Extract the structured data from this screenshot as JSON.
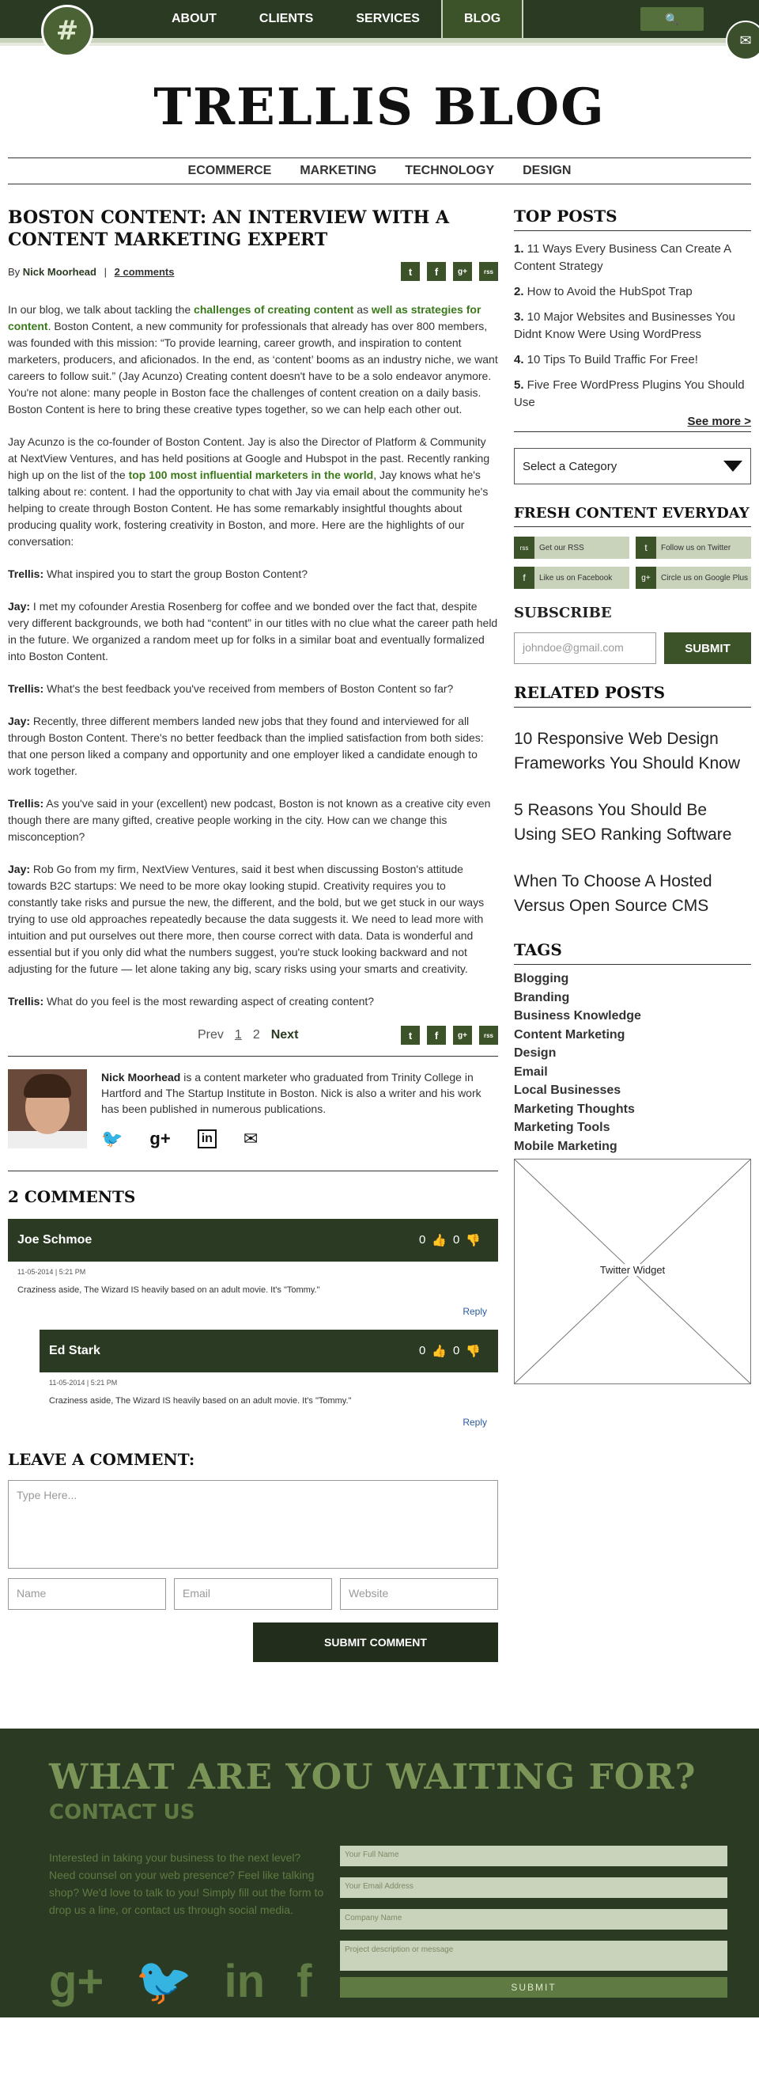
{
  "nav": {
    "logo_glyph": "#",
    "items": [
      "ABOUT",
      "CLIENTS",
      "SERVICES",
      "BLOG"
    ],
    "search_icon": "🔍",
    "mail_icon": "✉"
  },
  "blog_title": "TRELLIS BLOG",
  "categories": [
    "ECOMMERCE",
    "MARKETING",
    "TECHNOLOGY",
    "DESIGN"
  ],
  "post": {
    "title": "BOSTON CONTENT: AN INTERVIEW WITH A CONTENT MARKETING EXPERT",
    "by": "By",
    "author": "Nick Moorhead",
    "comments_link": "2 comments",
    "share_icons": [
      "t",
      "f",
      "g+",
      "rss"
    ],
    "p1": {
      "a": "In our blog, we talk about tackling the ",
      "link1": "challenges of creating content",
      "b": " as ",
      "link2": "well as strategies for content",
      "c": ". Boston Content, a new community for professionals that already has over 800 members, was founded with this mission: “To provide learning, career growth, and inspiration to content marketers, producers, and aficionados. In the end, as ‘content’ booms as an industry niche, we want careers to follow suit.” (Jay Acunzo) Creating content doesn't have to be a solo endeavor anymore. You're not alone: many people in Boston face the challenges of content creation on a daily basis. Boston Content is here to bring these creative types together, so we can help each other out."
    },
    "p2": {
      "a": "Jay Acunzo is the co-founder of Boston Content. Jay is also the Director of Platform & Community at NextView Ventures, and has held positions at Google and Hubspot in the past. Recently ranking high up on the list of the ",
      "link": "top 100 most influential marketers in the world",
      "b": ", Jay knows what he's talking about re: content. I had the opportunity to chat with Jay via email about the community he's helping to create through Boston Content. He has some remarkably insightful thoughts about producing quality work, fostering creativity in Boston, and more. Here are the highlights of our conversation:"
    },
    "qa": [
      {
        "speaker": "Trellis:",
        "text": " What inspired you to start the group Boston Content?"
      },
      {
        "speaker": "Jay:",
        "text": " I met my cofounder Arestia Rosenberg for coffee and we bonded over the fact that, despite very different backgrounds, we both had “content” in our titles with no clue what the career path held in the future. We organized a random meet up for folks in a similar boat and eventually formalized into Boston Content."
      },
      {
        "speaker": "Trellis:",
        "text": " What's the best feedback you've received from members of Boston Content so far?"
      },
      {
        "speaker": "Jay:",
        "text": " Recently, three different members landed new jobs that they found and interviewed for all through Boston Content. There's no better feedback than the implied satisfaction from both sides: that one person liked a company and opportunity and one employer liked a candidate enough to work together."
      },
      {
        "speaker": "Trellis:",
        "text": " As you've said in your (excellent) new podcast, Boston is not known as a creative city even though there are many gifted, creative people working in the city. How can we change this misconception?"
      },
      {
        "speaker": "Jay:",
        "text": " Rob Go from my firm, NextView Ventures, said it best when discussing Boston's attitude towards B2C startups: We need to be more okay looking stupid. Creativity requires you to constantly take risks and pursue the new, the different, and the bold, but we get stuck in our ways trying to use old approaches repeatedly because the data suggests it. We need to lead more with intuition and put ourselves out there more, then course correct with data. Data is wonderful and essential but if you only did what the numbers suggest, you're stuck looking backward and not adjusting for the future — let alone taking any big, scary risks using your smarts and creativity."
      },
      {
        "speaker": "Trellis:",
        "text": " What do you feel is the most rewarding aspect of creating content?"
      }
    ]
  },
  "pager": {
    "prev": "Prev",
    "p1": "1",
    "p2": "2",
    "next": "Next"
  },
  "author_box": {
    "name": "Nick Moorhead",
    "bio": " is a content marketer who graduated from Trinity College in Hartford and The Startup Institute in Boston. Nick is also a writer and his work has been published in numerous publications.",
    "social": [
      "🐦",
      "g+",
      "in",
      "✉"
    ]
  },
  "comments": {
    "heading": "2 COMMENTS",
    "items": [
      {
        "name": "Joe Schmoe",
        "up": "0",
        "down": "0",
        "date": "11-05-2014 | 5:21 PM",
        "text": "Craziness aside, The Wizard IS heavily based on an adult movie. It's \"Tommy.\"",
        "reply": "Reply"
      },
      {
        "name": "Ed Stark",
        "up": "0",
        "down": "0",
        "date": "11-05-2014 | 5:21 PM",
        "text": "Craziness aside, The Wizard IS heavily based on an adult movie. It's \"Tommy.\"",
        "reply": "Reply"
      }
    ],
    "thumb_up": "👍",
    "thumb_down": "👎"
  },
  "leave_comment": {
    "heading": "LEAVE A COMMENT:",
    "placeholder": "Type Here...",
    "name": "Name",
    "email": "Email",
    "website": "Website",
    "submit": "SUBMIT COMMENT"
  },
  "sidebar": {
    "top_posts_h": "TOP POSTS",
    "top_posts": [
      {
        "n": "1.",
        "t": " 11 Ways Every Business Can Create A Content Strategy"
      },
      {
        "n": "2.",
        "t": " How to Avoid the HubSpot Trap"
      },
      {
        "n": "3.",
        "t": " 10 Major Websites and Businesses You Didnt Know Were Using WordPress"
      },
      {
        "n": "4.",
        "t": " 10 Tips To Build Traffic For Free!"
      },
      {
        "n": "5.",
        "t": " Five Free WordPress Plugins You Should Use"
      }
    ],
    "see_more": "See more >",
    "select_category": "Select a Category",
    "fresh_h": "FRESH CONTENT EVERYDAY",
    "fresh": [
      {
        "icon": "rss",
        "label": "Get our RSS"
      },
      {
        "icon": "t",
        "label": "Follow us on Twitter"
      },
      {
        "icon": "f",
        "label": "Like us on Facebook"
      },
      {
        "icon": "g+",
        "label": "Circle us on Google Plus"
      }
    ],
    "subscribe_h": "SUBSCRIBE",
    "subscribe_placeholder": "johndoe@gmail.com",
    "subscribe_btn": "SUBMIT",
    "related_h": "RELATED POSTS",
    "related": [
      "10 Responsive Web Design Frameworks You Should Know",
      "5 Reasons You Should Be Using SEO Ranking Software",
      "When To Choose A Hosted Versus Open Source CMS"
    ],
    "tags_h": "TAGS",
    "tags": [
      "Blogging",
      "Branding",
      "Business Knowledge",
      "Content Marketing",
      "Design",
      "Email",
      "Local Businesses",
      "Marketing Thoughts",
      "Marketing Tools",
      "Mobile Marketing"
    ],
    "twitter_widget": "Twitter Widget"
  },
  "footer": {
    "cta": "WHAT ARE YOU WAITING FOR?",
    "contact_h": "CONTACT US",
    "text": "Interested in taking your business to the next level? Need counsel on your web presence? Feel like talking shop? We'd love to talk to you! Simply fill out the form to drop us a line, or contact us through social media.",
    "social": [
      "g+",
      "🐦",
      "in",
      "f"
    ],
    "full_name": "Your Full Name",
    "email": "Your Email Address",
    "company": "Company Name",
    "description": "Project description or message",
    "submit": "SUBMIT"
  }
}
